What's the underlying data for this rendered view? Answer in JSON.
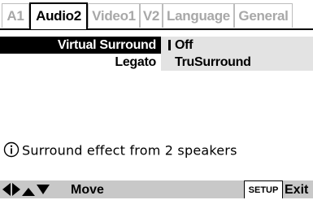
{
  "tabs": [
    {
      "label": "A1",
      "active": false
    },
    {
      "label": "Audio2",
      "active": true
    },
    {
      "label": "Video1",
      "active": false
    },
    {
      "label": "V2",
      "active": false
    },
    {
      "label": "Language",
      "active": false
    },
    {
      "label": "General",
      "active": false
    }
  ],
  "settings": [
    {
      "label": "Virtual Surround",
      "value": "Off",
      "highlighted": true
    },
    {
      "label": "Legato",
      "value": "TruSurround",
      "highlighted": false
    }
  ],
  "info": {
    "icon": "info-icon",
    "text": "Surround effect from 2 speakers"
  },
  "footer": {
    "nav_icons": [
      "arrow-left-icon",
      "arrow-right-icon",
      "arrow-up-icon",
      "arrow-down-icon"
    ],
    "move_label": "Move",
    "setup_label": "SETUP",
    "exit_label": "Exit"
  },
  "colors": {
    "highlight_bg": "#000000",
    "value_bg": "#e3e3e3",
    "inactive_tab": "#a8a8a8",
    "footer_bg": "#c8c8c8"
  }
}
